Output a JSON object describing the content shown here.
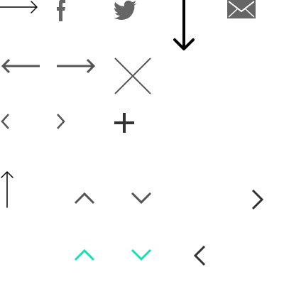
{
  "sprite_sheet": {
    "background": "#ffffff",
    "colors": {
      "black": "#000000",
      "dark_gray": "#333333",
      "gray": "#555555",
      "icon_fill_gray": "#666666",
      "teal": "#14e0b0"
    },
    "icons": [
      "arrow-right-thin-icon",
      "facebook-icon",
      "twitter-icon",
      "arrow-down-bold-icon",
      "mail-icon",
      "arrow-left-icon",
      "arrow-right-icon",
      "close-icon",
      "chevron-left-small-icon",
      "chevron-right-small-icon",
      "plus-icon",
      "arrow-up-thin-icon",
      "chevron-up-icon",
      "chevron-down-icon",
      "chevron-right-icon",
      "chevron-up-teal-icon",
      "chevron-down-teal-icon",
      "chevron-left-icon"
    ]
  }
}
